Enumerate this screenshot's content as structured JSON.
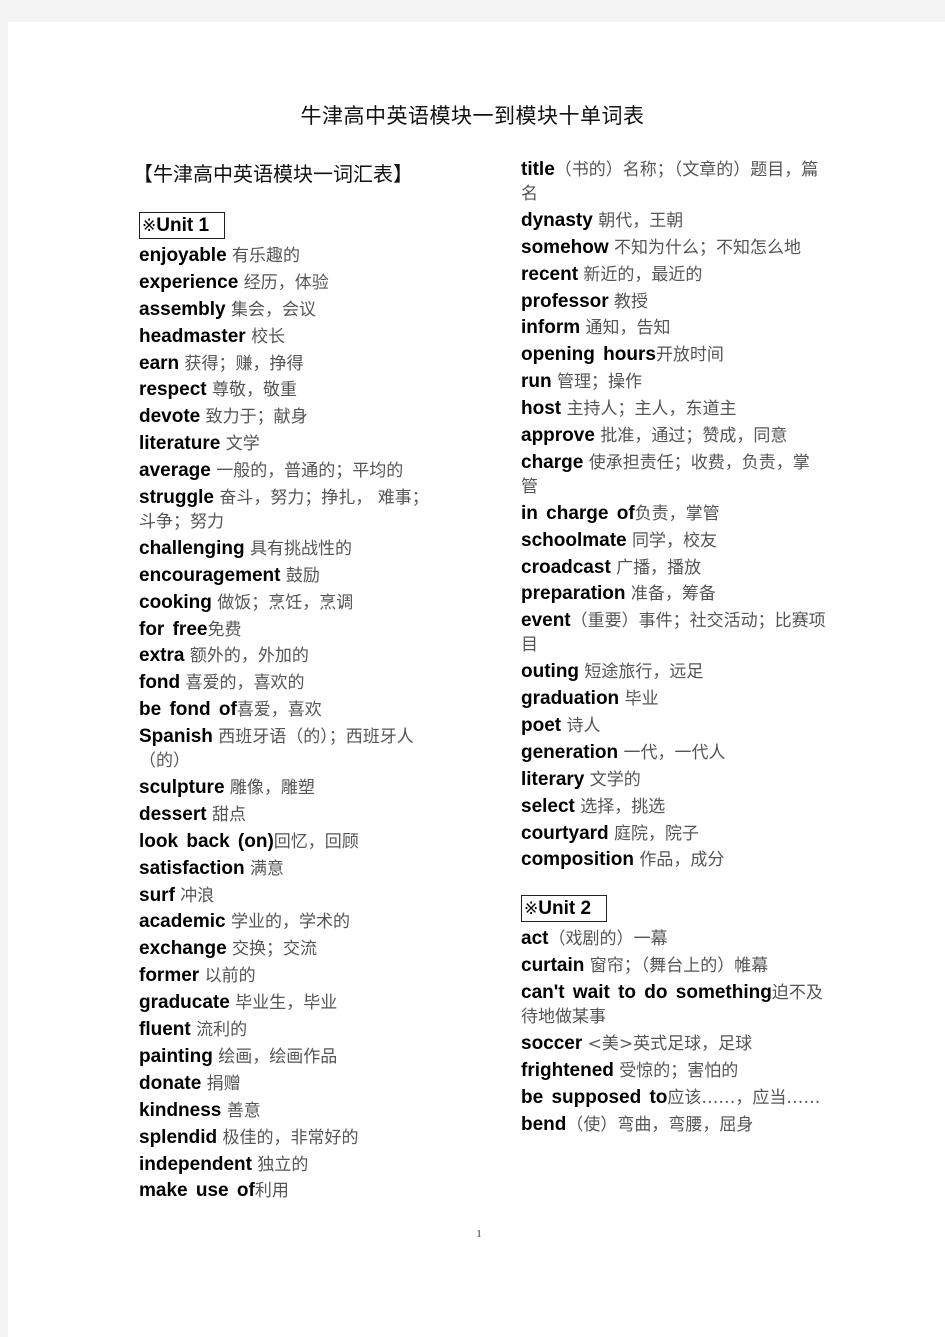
{
  "document": {
    "title": "牛津高中英语模块一到模块十单词表",
    "section_title": "【牛津高中英语模块一词汇表】",
    "page_number": "1"
  },
  "units": {
    "unit1": {
      "mark": "※",
      "label": "Unit 1"
    },
    "unit2": {
      "mark": "※",
      "label": "Unit 2"
    }
  },
  "left_column": [
    {
      "word": "enjoyable",
      "meaning": " 有乐趣的"
    },
    {
      "word": "experience",
      "meaning": " 经历，体验"
    },
    {
      "word": "assembly",
      "meaning": " 集会，会议"
    },
    {
      "word": "headmaster",
      "meaning": " 校长"
    },
    {
      "word": "earn",
      "meaning": " 获得；赚，挣得"
    },
    {
      "word": "respect",
      "meaning": " 尊敬，敬重"
    },
    {
      "word": "devote",
      "meaning": " 致力于；献身"
    },
    {
      "word": "literature",
      "meaning": " 文学"
    },
    {
      "word": "average",
      "meaning": " 一般的，普通的；平均的"
    },
    {
      "word": "struggle",
      "meaning": " 奋斗，努力；挣扎， 难事；斗争；努力"
    },
    {
      "word": "challenging",
      "meaning": " 具有挑战性的"
    },
    {
      "word": "encouragement",
      "meaning": " 鼓励"
    },
    {
      "word": "cooking",
      "meaning": " 做饭；烹饪，烹调"
    },
    {
      "word": "for free",
      "meaning": "免费"
    },
    {
      "word": "extra",
      "meaning": " 额外的，外加的"
    },
    {
      "word": "fond",
      "meaning": " 喜爱的，喜欢的"
    },
    {
      "word": "be fond of",
      "meaning": "喜爱，喜欢"
    },
    {
      "word": "Spanish",
      "meaning": " 西班牙语（的）；西班牙人（的）"
    },
    {
      "word": "sculpture",
      "meaning": " 雕像，雕塑"
    },
    {
      "word": "dessert",
      "meaning": " 甜点"
    },
    {
      "word": "look back (on)",
      "meaning": "回忆，回顾"
    },
    {
      "word": "satisfaction",
      "meaning": "  满意"
    },
    {
      "word": "surf",
      "meaning": " 冲浪"
    },
    {
      "word": "academic",
      "meaning": " 学业的，学术的"
    },
    {
      "word": "exchange",
      "meaning": " 交换；交流"
    },
    {
      "word": "former",
      "meaning": " 以前的"
    },
    {
      "word": "graducate",
      "meaning": " 毕业生，毕业"
    },
    {
      "word": "fluent",
      "meaning": " 流利的"
    },
    {
      "word": "painting",
      "meaning": " 绘画，绘画作品"
    },
    {
      "word": "donate",
      "meaning": " 捐赠"
    },
    {
      "word": "kindness",
      "meaning": " 善意"
    },
    {
      "word": "splendid",
      "meaning": " 极佳的，非常好的"
    },
    {
      "word": "independent",
      "meaning": " 独立的"
    },
    {
      "word": "make use of",
      "meaning": "利用"
    }
  ],
  "right_column_unit1": [
    {
      "word": "title",
      "meaning": "（书的）名称；（文章的）题目，篇名"
    },
    {
      "word": "dynasty",
      "meaning": " 朝代，王朝"
    },
    {
      "word": "somehow",
      "meaning": " 不知为什么；不知怎么地"
    },
    {
      "word": "recent",
      "meaning": " 新近的，最近的"
    },
    {
      "word": "professor",
      "meaning": " 教授"
    },
    {
      "word": "inform",
      "meaning": " 通知，告知"
    },
    {
      "word": "opening hours",
      "meaning": "开放时间"
    },
    {
      "word": "run",
      "meaning": " 管理；操作"
    },
    {
      "word": "host",
      "meaning": " 主持人；主人，东道主"
    },
    {
      "word": "approve",
      "meaning": " 批准，通过；赞成，同意"
    },
    {
      "word": "charge",
      "meaning": " 使承担责任；收费，负责，掌管"
    },
    {
      "word": "in charge of",
      "meaning": "负责，掌管"
    },
    {
      "word": "schoolmate",
      "meaning": " 同学，校友"
    },
    {
      "word": "croadcast",
      "meaning": " 广播，播放"
    },
    {
      "word": "preparation",
      "meaning": " 准备，筹备"
    },
    {
      "word": "event",
      "meaning": "（重要）事件；社交活动；比赛项目"
    },
    {
      "word": "outing",
      "meaning": " 短途旅行，远足"
    },
    {
      "word": "graduation",
      "meaning": " 毕业"
    },
    {
      "word": "poet",
      "meaning": " 诗人"
    },
    {
      "word": "generation",
      "meaning": " 一代，一代人"
    },
    {
      "word": "literary",
      "meaning": " 文学的"
    },
    {
      "word": "select",
      "meaning": " 选择，挑选"
    },
    {
      "word": "courtyard",
      "meaning": " 庭院，院子"
    },
    {
      "word": "composition",
      "meaning": " 作品，成分"
    }
  ],
  "right_column_unit2": [
    {
      "word": "act",
      "meaning": "（戏剧的）一幕"
    },
    {
      "word": "curtain",
      "meaning": " 窗帘；（舞台上的）帷幕"
    },
    {
      "word": "can't wait to do something",
      "meaning": "迫不及待地做某事"
    },
    {
      "word": "soccer",
      "meaning": "  <美>英式足球，足球"
    },
    {
      "word": "frightened",
      "meaning": " 受惊的；害怕的"
    },
    {
      "word": "be supposed to",
      "meaning": "应该……，应当……"
    },
    {
      "word": "bend",
      "meaning": "（使）弯曲，弯腰，屈身"
    }
  ]
}
